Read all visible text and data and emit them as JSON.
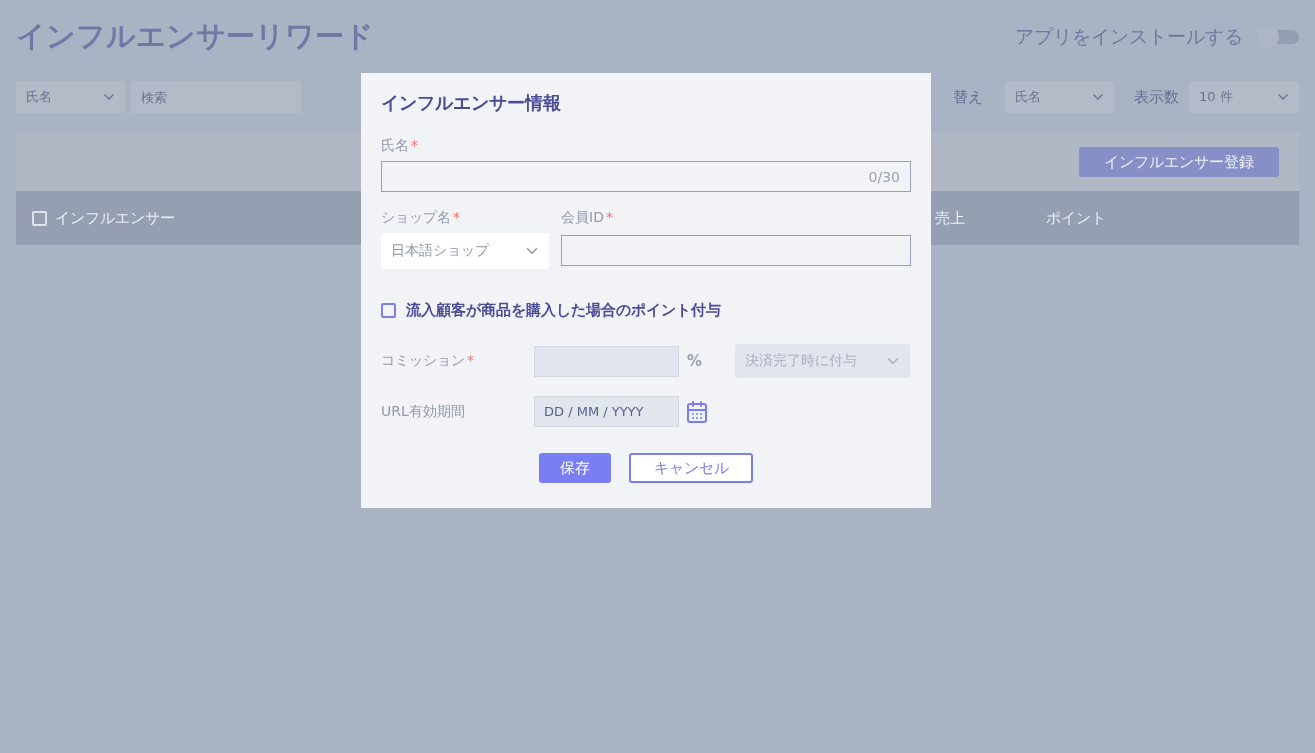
{
  "page": {
    "title": "インフルエンサーリワード",
    "install": {
      "label": "アプリをインストールする",
      "on": false
    }
  },
  "filters": {
    "field": "氏名",
    "search_placeholder": "検索",
    "sort_label": "替え",
    "sort_value": "氏名",
    "count_label": "表示数",
    "count_value": "10 件"
  },
  "toolbar": {
    "button": "インフルエンサー登録"
  },
  "table": {
    "columns": [
      {
        "label": "インフルエンサー",
        "checked": false
      },
      {
        "label": "売上"
      },
      {
        "label": "ポイント"
      }
    ]
  },
  "dialog": {
    "title": "インフルエンサー情報",
    "name": {
      "label": "氏名",
      "mark": "*",
      "counter": "0/30"
    },
    "shop": {
      "label": "ショップ名",
      "mark": "*",
      "value": "日本語ショップ"
    },
    "member": {
      "label": "会員ID",
      "mark": "*"
    },
    "points_option": {
      "label": "流入顧客が商品を購入した場合のポイント付与",
      "checked": false
    },
    "commission": {
      "label": "コミッション",
      "mark": "*",
      "unit": "%",
      "timing": "決済完了時に付与",
      "disabled": true
    },
    "url_period": {
      "label": "URL有効期間",
      "placeholder": "DD / MM / YYYY"
    },
    "buttons": [
      {
        "label": "保存",
        "kind": "primary"
      },
      {
        "label": "キャンセル",
        "kind": "secondary"
      }
    ]
  }
}
